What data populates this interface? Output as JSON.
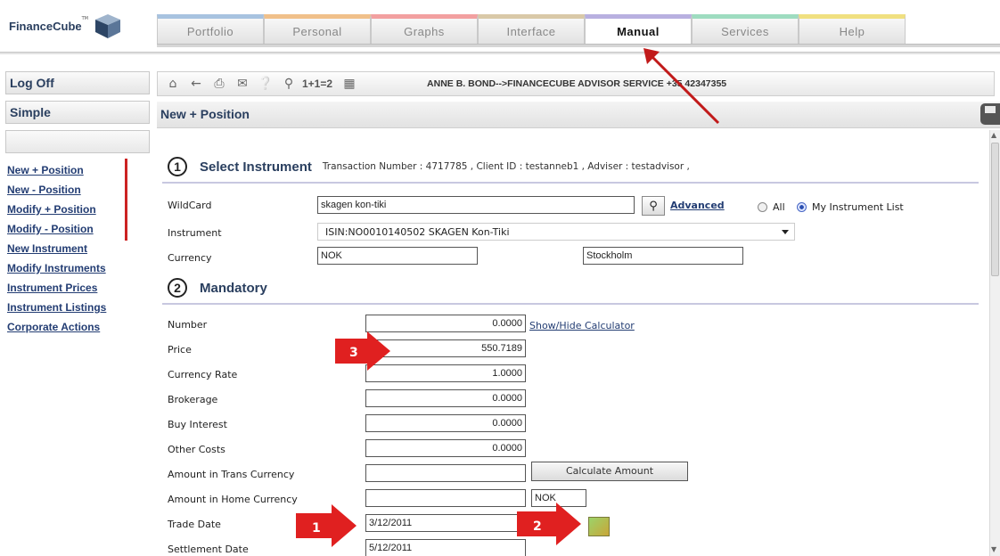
{
  "logo": {
    "text": "FinanceCube",
    "tm": "TM"
  },
  "tabs": [
    "Portfolio",
    "Personal",
    "Graphs",
    "Interface",
    "Manual",
    "Services",
    "Help"
  ],
  "active_tab": "Manual",
  "sidebar": {
    "logoff": "Log Off",
    "simple": "Simple",
    "links": [
      "New + Position",
      "New - Position",
      "Modify + Position",
      "Modify - Position",
      "New Instrument",
      "Modify Instruments",
      "Instrument Prices",
      "Instrument Listings",
      "Corporate Actions"
    ]
  },
  "toolbar": {
    "calc_label": "1+1=2",
    "advisor_text": "ANNE B. BOND-->FINANCECUBE ADVISOR SERVICE +35 42347355"
  },
  "page_title": "New + Position",
  "section1": {
    "number": "1",
    "title": "Select Instrument",
    "info": "Transaction Number : 4717785 , Client ID : testanneb1 , Adviser : testadvisor ,"
  },
  "wildcard": {
    "label": "WildCard",
    "value": "skagen kon-tiki",
    "advanced": "Advanced",
    "all": "All",
    "my_list": "My Instrument List"
  },
  "instrument": {
    "label": "Instrument",
    "value": "ISIN:NO0010140502 SKAGEN Kon-Tiki"
  },
  "currency": {
    "label": "Currency",
    "value": "NOK",
    "exchange": "Stockholm"
  },
  "section2": {
    "number": "2",
    "title": "Mandatory"
  },
  "fields": {
    "number": {
      "label": "Number",
      "value": "0.0000",
      "link": "Show/Hide Calculator"
    },
    "price": {
      "label": "Price",
      "value": "550.7189"
    },
    "currency_rate": {
      "label": "Currency Rate",
      "value": "1.0000"
    },
    "brokerage": {
      "label": "Brokerage",
      "value": "0.0000"
    },
    "buy_interest": {
      "label": "Buy Interest",
      "value": "0.0000"
    },
    "other_costs": {
      "label": "Other Costs",
      "value": "0.0000"
    },
    "amount_trans": {
      "label": "Amount in Trans Currency",
      "value": "",
      "button": "Calculate Amount"
    },
    "amount_home": {
      "label": "Amount in Home Currency",
      "value": "",
      "currency": "NOK"
    },
    "trade_date": {
      "label": "Trade Date",
      "value": "3/12/2011"
    },
    "settlement_date": {
      "label": "Settlement Date",
      "value": "5/12/2011"
    }
  },
  "annotations": {
    "one": "1",
    "two": "2",
    "three": "3",
    "color": "#e02020"
  }
}
